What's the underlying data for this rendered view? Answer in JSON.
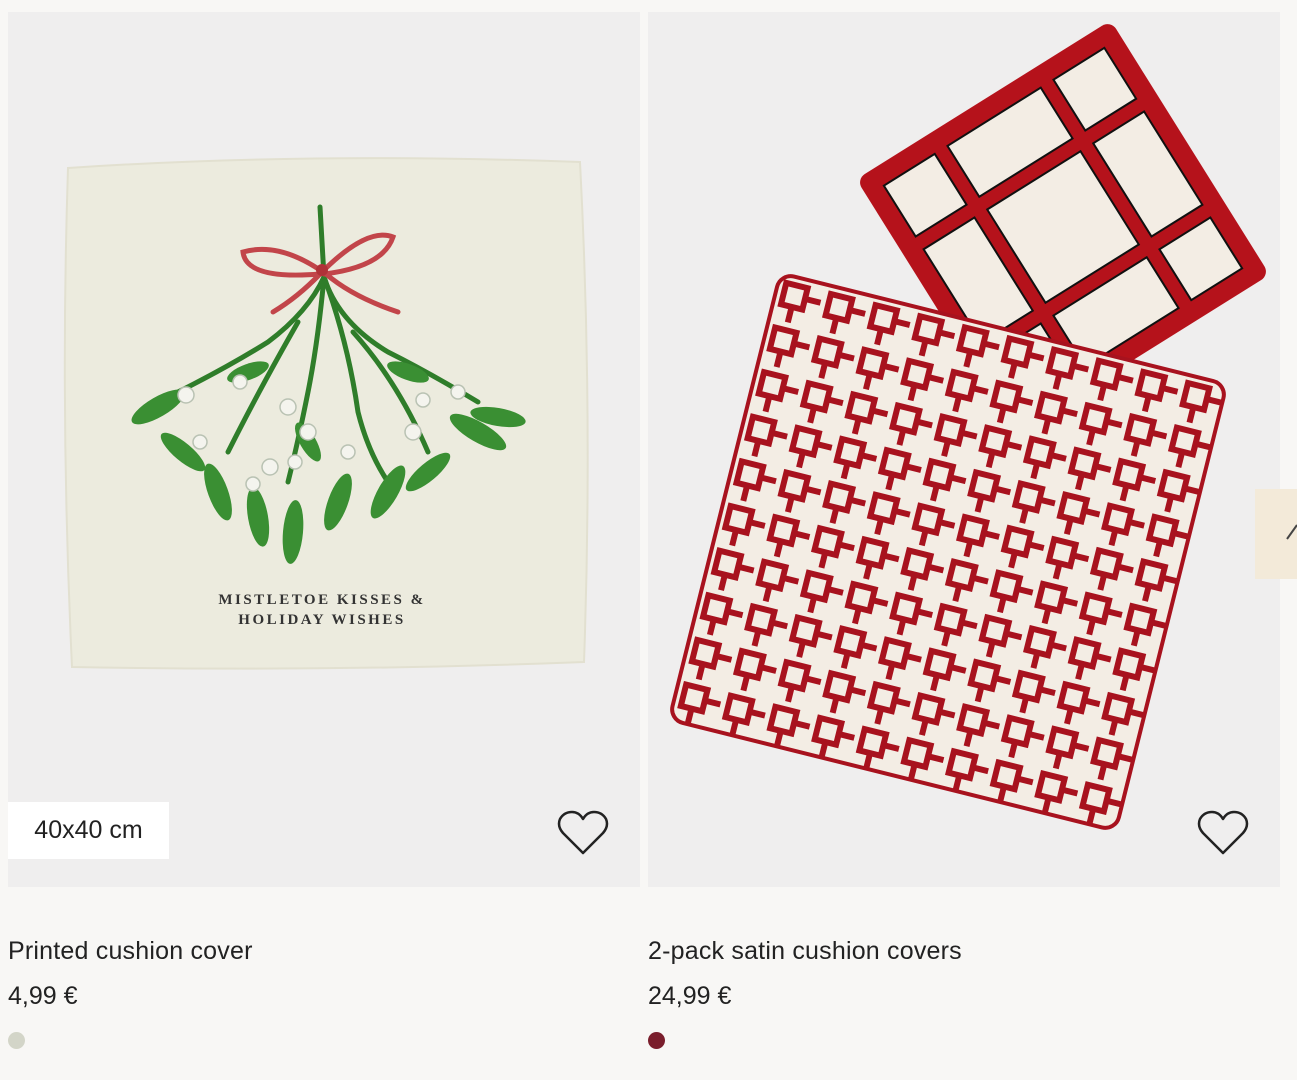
{
  "products": [
    {
      "name": "Printed cushion cover",
      "price": "4,99 €",
      "size_badge": "40x40 cm",
      "image_text_line1": "MISTLETOE KISSES &",
      "image_text_line2": "HOLIDAY WISHES",
      "favorite_icon": "heart-outline-icon",
      "swatch_color": "#d3d5c8"
    },
    {
      "name": "2-pack satin cushion covers",
      "price": "24,99 €",
      "favorite_icon": "heart-outline-icon",
      "swatch_color": "#7a1e2c"
    }
  ],
  "carousel": {
    "next_icon": "arrow-right-icon"
  },
  "colors": {
    "page_bg": "#f8f7f5",
    "image_bg": "#efeeee",
    "accent_red": "#b5121b",
    "badge_bg": "#ffffff"
  }
}
